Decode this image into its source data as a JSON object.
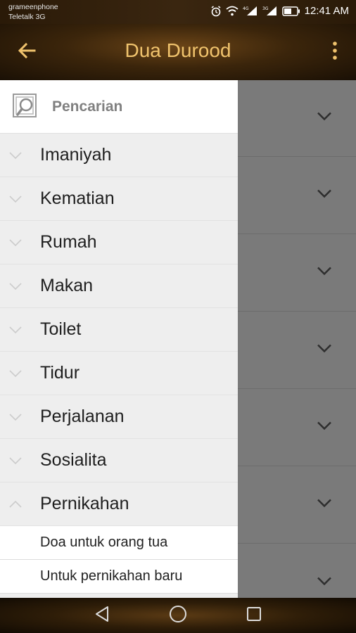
{
  "status_bar": {
    "carrier_line1": "grameenphone",
    "carrier_line2": "Teletalk 3G",
    "time": "12:41 AM"
  },
  "app_bar": {
    "title": "Dua Durood",
    "back_icon": "arrow-left-icon",
    "menu_icon": "more-vert-icon",
    "title_color": "#f0c36d"
  },
  "drawer": {
    "search_label": "Pencarian",
    "categories": [
      {
        "label": "Imaniyah",
        "expanded": false
      },
      {
        "label": "Kematian",
        "expanded": false
      },
      {
        "label": "Rumah",
        "expanded": false
      },
      {
        "label": "Makan",
        "expanded": false
      },
      {
        "label": "Toilet",
        "expanded": false
      },
      {
        "label": "Tidur",
        "expanded": false
      },
      {
        "label": "Perjalanan",
        "expanded": false
      },
      {
        "label": "Sosialita",
        "expanded": false
      },
      {
        "label": "Pernikahan",
        "expanded": true
      }
    ],
    "subitems": [
      {
        "label": "Doa untuk orang tua"
      },
      {
        "label": "Untuk pernikahan baru"
      }
    ]
  },
  "nav_bar": {
    "back": "triangle-back-icon",
    "home": "circle-home-icon",
    "recents": "square-recents-icon"
  }
}
